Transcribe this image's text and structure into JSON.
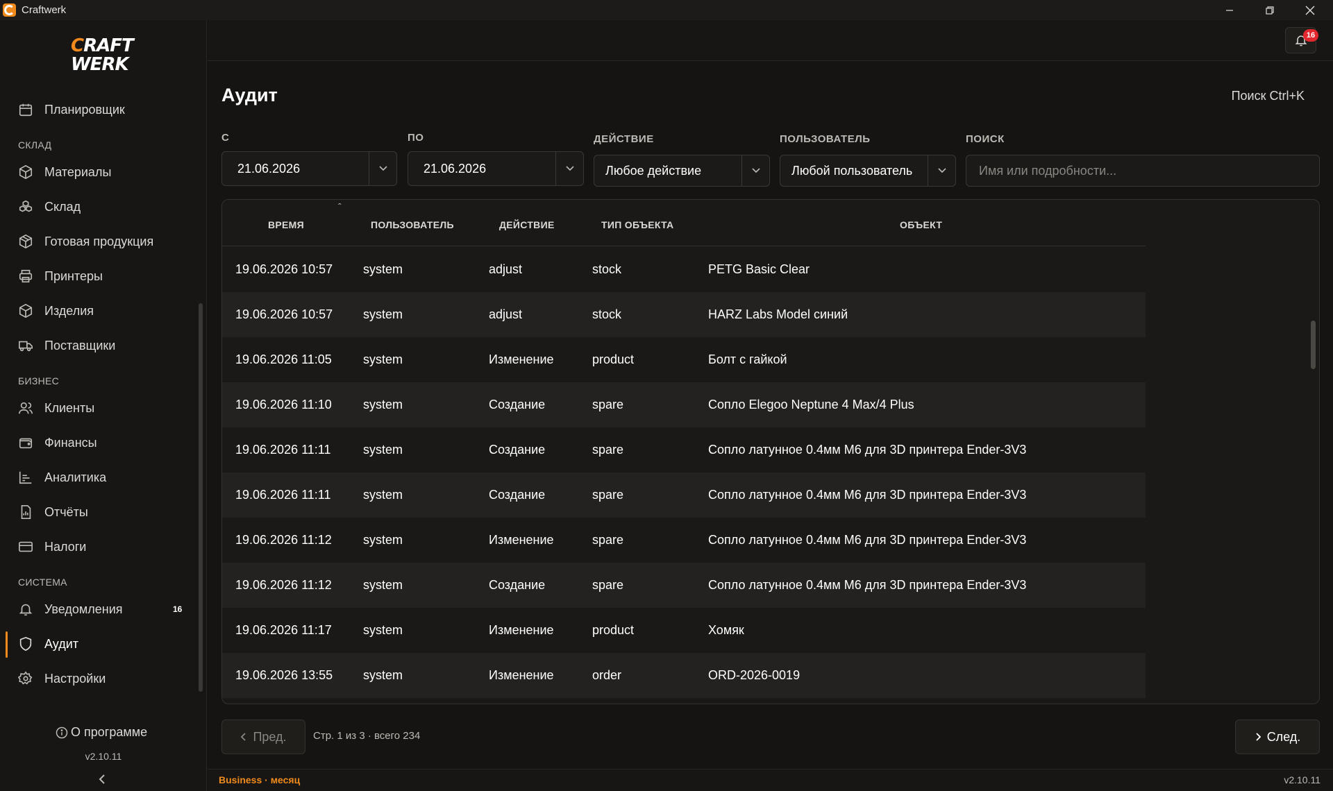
{
  "window": {
    "title": "Craftwerk",
    "controls": [
      "minimize",
      "restore",
      "close"
    ]
  },
  "sidebar": {
    "logo": {
      "line1_c": "C",
      "line1_rest": "RAFT",
      "line2": "WERK"
    },
    "top_item": {
      "label": "Планировщик",
      "icon": "calendar-icon"
    },
    "sections": [
      {
        "title": "СКЛАД",
        "items": [
          {
            "label": "Материалы",
            "icon": "cube-icon"
          },
          {
            "label": "Склад",
            "icon": "boxes-icon"
          },
          {
            "label": "Готовая продукция",
            "icon": "package-icon"
          },
          {
            "label": "Принтеры",
            "icon": "printer-icon"
          },
          {
            "label": "Изделия",
            "icon": "product-icon"
          },
          {
            "label": "Поставщики",
            "icon": "truck-icon"
          }
        ]
      },
      {
        "title": "БИЗНЕС",
        "items": [
          {
            "label": "Клиенты",
            "icon": "users-icon"
          },
          {
            "label": "Финансы",
            "icon": "wallet-icon"
          },
          {
            "label": "Аналитика",
            "icon": "chart-icon"
          },
          {
            "label": "Отчёты",
            "icon": "report-icon"
          },
          {
            "label": "Налоги",
            "icon": "card-icon"
          }
        ]
      },
      {
        "title": "СИСТЕМА",
        "items": [
          {
            "label": "Уведомления",
            "icon": "bell-icon",
            "badge": "16"
          },
          {
            "label": "Аудит",
            "icon": "shield-icon",
            "active": true
          },
          {
            "label": "Настройки",
            "icon": "gear-icon"
          }
        ]
      }
    ],
    "about": "О программе",
    "version": "v2.10.11"
  },
  "header": {
    "notifications_count": "16"
  },
  "page": {
    "title": "Аудит",
    "search_hint": "Поиск  Ctrl+K"
  },
  "filters": {
    "from": {
      "label": "С",
      "value": "21.06.2026"
    },
    "to": {
      "label": "ПО",
      "value": "21.06.2026"
    },
    "action": {
      "label": "ДЕЙСТВИЕ",
      "value": "Любое действие"
    },
    "user": {
      "label": "ПОЛЬЗОВАТЕЛЬ",
      "value": "Любой пользователь"
    },
    "search": {
      "label": "ПОИСК",
      "placeholder": "Имя или подробности..."
    }
  },
  "table": {
    "columns": [
      "ВРЕМЯ",
      "ПОЛЬЗОВАТЕЛЬ",
      "ДЕЙСТВИЕ",
      "ТИП ОБЪЕКТА",
      "ОБЪЕКТ"
    ],
    "sort_indicator": "ˆ",
    "rows": [
      [
        "19.06.2026 10:57",
        "system",
        "adjust",
        "stock",
        "PETG Basic Clear"
      ],
      [
        "19.06.2026 10:57",
        "system",
        "adjust",
        "stock",
        "HARZ Labs Model синий"
      ],
      [
        "19.06.2026 11:05",
        "system",
        "Изменение",
        "product",
        "Болт с гайкой"
      ],
      [
        "19.06.2026 11:10",
        "system",
        "Создание",
        "spare",
        "Сопло Elegoo Neptune 4 Max/4 Plus"
      ],
      [
        "19.06.2026 11:11",
        "system",
        "Создание",
        "spare",
        "Сопло латунное 0.4мм M6 для 3D принтера Ender-3V3"
      ],
      [
        "19.06.2026 11:11",
        "system",
        "Создание",
        "spare",
        "Сопло латунное 0.4мм M6 для 3D принтера Ender-3V3"
      ],
      [
        "19.06.2026 11:12",
        "system",
        "Изменение",
        "spare",
        "Сопло латунное 0.4мм M6 для 3D принтера Ender-3V3"
      ],
      [
        "19.06.2026 11:12",
        "system",
        "Создание",
        "spare",
        "Сопло латунное 0.4мм M6 для 3D принтера Ender-3V3"
      ],
      [
        "19.06.2026 11:17",
        "system",
        "Изменение",
        "product",
        "Хомяк"
      ],
      [
        "19.06.2026 13:55",
        "system",
        "Изменение",
        "order",
        "ORD-2026-0019"
      ]
    ]
  },
  "pagination": {
    "prev": "Пред.",
    "next": "След.",
    "info": "Стр. 1 из 3 · всего 234"
  },
  "status": {
    "plan": "Business · месяц",
    "version": "v2.10.11"
  },
  "colors": {
    "accent": "#f08a1d",
    "badge": "#e0282e",
    "background": "#161412"
  }
}
